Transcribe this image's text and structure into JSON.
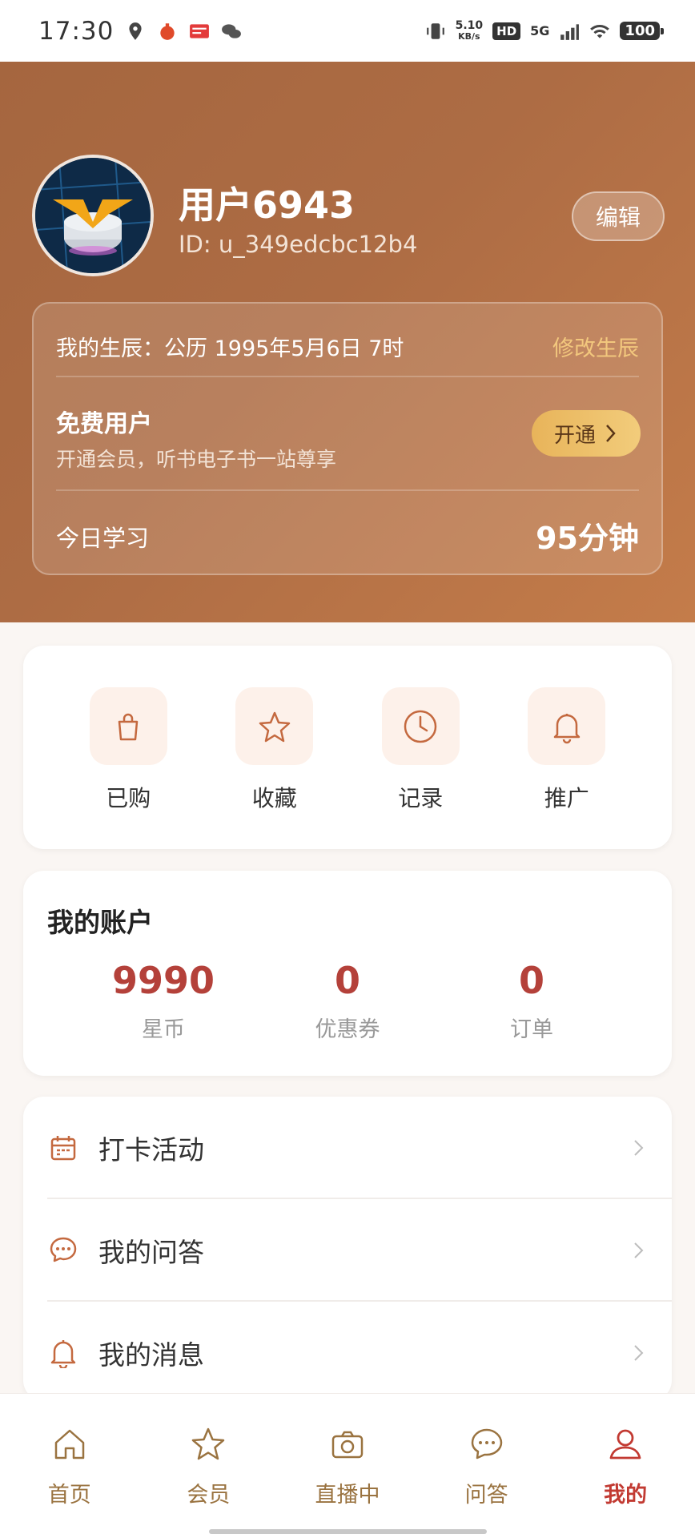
{
  "status_bar": {
    "time": "17:30",
    "speed_value": "5.10",
    "speed_unit": "KB/s",
    "hd": "HD",
    "network": "5G",
    "battery": "100"
  },
  "profile": {
    "name": "用户6943",
    "id": "ID: u_349edcbc12b4",
    "edit_label": "编辑"
  },
  "info_card": {
    "birth": "我的生辰：公历 1995年5月6日 7时",
    "modify_label": "修改生辰",
    "member_title": "免费用户",
    "member_sub": "开通会员，听书电子书一站尊享",
    "open_label": "开通",
    "study_label": "今日学习",
    "study_minutes": "95分钟"
  },
  "quick_actions": [
    {
      "label": "已购",
      "icon": "shopping-bag-icon"
    },
    {
      "label": "收藏",
      "icon": "star-icon"
    },
    {
      "label": "记录",
      "icon": "clock-icon"
    },
    {
      "label": "推广",
      "icon": "bell-icon"
    }
  ],
  "account": {
    "title": "我的账户",
    "stats": [
      {
        "value": "9990",
        "label": "星币"
      },
      {
        "value": "0",
        "label": "优惠券"
      },
      {
        "value": "0",
        "label": "订单"
      }
    ]
  },
  "menu": [
    {
      "label": "打卡活动",
      "icon": "calendar-icon"
    },
    {
      "label": "我的问答",
      "icon": "chat-bubble-icon"
    },
    {
      "label": "我的消息",
      "icon": "bell-icon"
    }
  ],
  "bottom_nav": [
    {
      "label": "首页",
      "icon": "home-icon"
    },
    {
      "label": "会员",
      "icon": "star-icon"
    },
    {
      "label": "直播中",
      "icon": "camera-icon"
    },
    {
      "label": "问答",
      "icon": "chat-bubble-icon"
    },
    {
      "label": "我的",
      "icon": "user-icon",
      "active": true
    }
  ],
  "colors": {
    "accent": "#c23a32",
    "header": "#a5663f",
    "gold": "#f2cc7b",
    "icon": "#c4693f"
  }
}
